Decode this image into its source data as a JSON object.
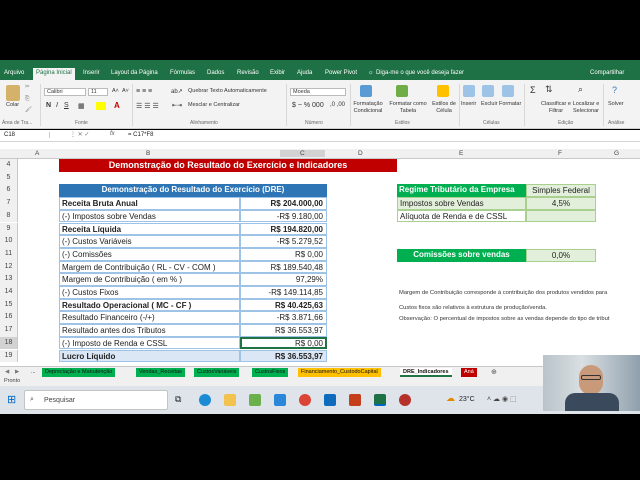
{
  "ribbon_tabs": [
    "Arquivo",
    "Página Inicial",
    "Inserir",
    "Layout da Página",
    "Fórmulas",
    "Dados",
    "Revisão",
    "Exibir",
    "Ajuda",
    "Power Pivot",
    "Diga-me o que você deseja fazer",
    "Compartilhar"
  ],
  "ribbon": {
    "paste": "Colar",
    "font_name": "Calibri",
    "font_size": "11",
    "wrap_text": "Quebrar Texto Automaticamente",
    "merge_center": "Mesclar e Centralizar",
    "number_format": "Moeda",
    "cond_format": "Formatação Condicional",
    "format_table": "Formatar como Tabela",
    "cell_styles": "Estilos de Célula",
    "insert": "Inserir",
    "delete": "Excluir",
    "format": "Formatar",
    "sort_filter": "Classificar e Filtrar",
    "find_select": "Localizar e Selecionar",
    "solver": "Solver",
    "groups": [
      "Área de Tra...",
      "Fonte",
      "Alinhamento",
      "Número",
      "Estilos",
      "Células",
      "Edição",
      "Análise"
    ],
    "bold": "N",
    "italic": "I",
    "underline": "S"
  },
  "formula_bar": {
    "name_box": "C18",
    "fx": "fx",
    "formula": "= C17*F8"
  },
  "columns": [
    "A",
    "B",
    "C",
    "D",
    "E",
    "F",
    "G"
  ],
  "rows": [
    "4",
    "5",
    "6",
    "7",
    "8",
    "9",
    "10",
    "11",
    "12",
    "13",
    "14",
    "15",
    "16",
    "17",
    "18",
    "19"
  ],
  "title": "Demonstração do Resultado do Exercício e Indicadores",
  "dre": {
    "header": "Demonstração do Resultado do Exercício (DRE)",
    "lines": [
      {
        "label": "Receita Bruta Anual",
        "value": "R$ 204.000,00",
        "bold": true
      },
      {
        "label": "(-) Impostos sobre Vendas",
        "value": "-R$ 9.180,00",
        "bold": false
      },
      {
        "label": "Receita Líquida",
        "value": "R$ 194.820,00",
        "bold": true
      },
      {
        "label": "(-) Custos Variáveis",
        "value": "-R$ 5.279,52",
        "bold": false
      },
      {
        "label": "(-) Comissões",
        "value": "R$ 0,00",
        "bold": false
      },
      {
        "label": "Margem de Contribuição ( RL - CV - COM )",
        "value": "R$ 189.540,48",
        "bold": false
      },
      {
        "label": "Margem de Contribuição ( em % )",
        "value": "97,29%",
        "bold": false
      },
      {
        "label": "(-) Custos Fixos",
        "value": "-R$ 149.114,85",
        "bold": false
      },
      {
        "label": "Resultado Operacional ( MC - CF )",
        "value": "R$ 40.425,63",
        "bold": true
      },
      {
        "label": "Resultado Financeiro (-/+)",
        "value": "-R$ 3.871,66",
        "bold": false
      },
      {
        "label": "Resultado antes dos Tributos",
        "value": "R$ 36.553,97",
        "bold": false
      },
      {
        "label": "(-) Imposto de Renda e CSSL",
        "value": "R$ 0,00",
        "bold": false
      },
      {
        "label": "Lucro Líquido",
        "value": "R$ 36.553,97",
        "bold": true
      }
    ]
  },
  "regime": {
    "label": "Regime Tributário da Empresa",
    "value": "Simples Federal",
    "impostos_label": "Impostos sobre Vendas",
    "impostos_value": "4,5%",
    "aliquota_label": "Alíquota de Renda e de CSSL",
    "aliquota_value": ""
  },
  "comissoes": {
    "label": "Comissões sobre vendas",
    "value": "0,0%"
  },
  "notes": [
    "Margem de Contribuição corresponde à contribuição dos produtos vendidos para",
    "Custos fixos são relativos à estrutura de produção/venda.",
    "Observação: O percentual de impostos sobre as vendas depende do tipo de tribut"
  ],
  "sheet_tabs": [
    {
      "label": "...",
      "color": "#f0f0f0"
    },
    {
      "label": "Depreciação e Manutenção",
      "color": "#00b050"
    },
    {
      "label": "Vendas_Receitas",
      "color": "#00b050"
    },
    {
      "label": "CustosVariáveis",
      "color": "#00b050"
    },
    {
      "label": "CustosFixos",
      "color": "#00b050"
    },
    {
      "label": "Financiamento_CustodoCapital",
      "color": "#ffc000"
    },
    {
      "label": "DRE_Indicadores",
      "color": "#ffffff"
    },
    {
      "label": "Aná",
      "color": "#c00000"
    }
  ],
  "status": "Pronto",
  "taskbar": {
    "search_placeholder": "Pesquisar",
    "temperature": "23°C"
  },
  "colors": {
    "excel_green": "#1e7145",
    "dre_red": "#c00000",
    "dre_blue": "#2e75b6",
    "regime_green": "#00b050"
  }
}
